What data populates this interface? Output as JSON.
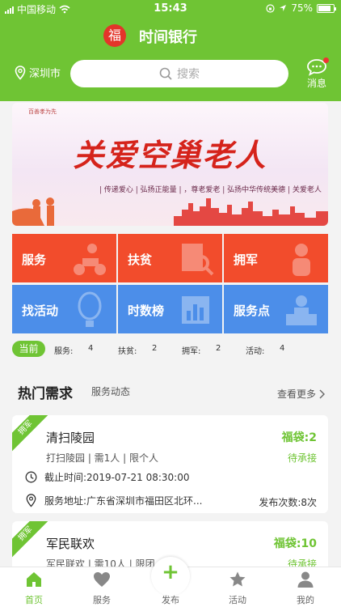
{
  "status_bar": {
    "carrier": "中国移动",
    "time": "15:43",
    "battery": "75%"
  },
  "header": {
    "title": "时间银行",
    "logo_char": "福",
    "city": "深圳市",
    "search_placeholder": "搜索",
    "message_label": "消息"
  },
  "banner": {
    "top_text": "百善孝为先",
    "title": "关爱空巢老人",
    "subtitle": "| 传递爱心 | 弘扬正能量 | ，尊老爱老 | 弘扬中华传统美德 | 关爱老人"
  },
  "categories": [
    {
      "label": "服务",
      "icon": "scooter-icon"
    },
    {
      "label": "扶贫",
      "icon": "document-search-icon"
    },
    {
      "label": "拥军",
      "icon": "soldier-icon"
    },
    {
      "label": "找活动",
      "icon": "balloon-icon"
    },
    {
      "label": "时数榜",
      "icon": "chart-icon"
    },
    {
      "label": "服务点",
      "icon": "service-desk-icon"
    }
  ],
  "stats": {
    "current_label": "当前",
    "items": [
      {
        "label": "服务:",
        "value": "4"
      },
      {
        "label": "扶贫:",
        "value": "2"
      },
      {
        "label": "拥军:",
        "value": "2"
      },
      {
        "label": "活动:",
        "value": "4"
      }
    ]
  },
  "section": {
    "title": "热门需求",
    "tab": "服务动态",
    "see_more": "查看更多"
  },
  "cards": [
    {
      "tag": "拥军",
      "title": "清扫陵园",
      "reward": "福袋:2",
      "desc": "打扫陵园 | 需1人 | 限个人",
      "status": "待承接",
      "deadline": "截止时间:2019-07-21 08:30:00",
      "address": "服务地址:广东省深圳市福田区北环...",
      "count": "发布次数:8次"
    },
    {
      "tag": "拥军",
      "title": "军民联欢",
      "reward": "福袋:10",
      "desc": "军民联欢 | 需10人 | 限团",
      "status": "待承接"
    }
  ],
  "tabbar": {
    "items": [
      {
        "label": "首页",
        "icon": "home-icon"
      },
      {
        "label": "服务",
        "icon": "heart-icon"
      },
      {
        "label": "发布",
        "icon": "plus-icon"
      },
      {
        "label": "活动",
        "icon": "star-icon"
      },
      {
        "label": "我的",
        "icon": "person-icon"
      }
    ]
  },
  "colors": {
    "brand_green": "#6fc434",
    "tile_red": "#f24c2c",
    "tile_blue": "#4c8ee9"
  }
}
